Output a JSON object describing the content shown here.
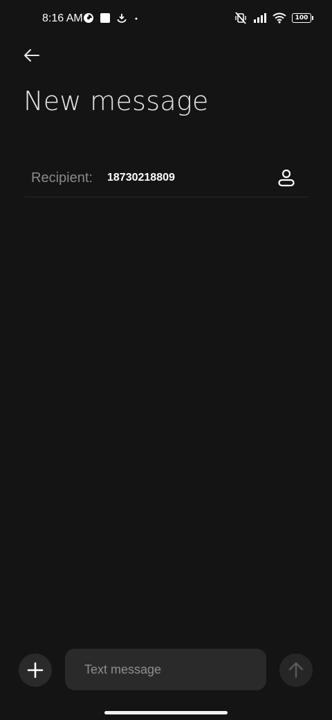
{
  "status_bar": {
    "time": "8:16 AM",
    "battery": "100",
    "left_icons": [
      "data-saver-icon",
      "square-app-icon",
      "download-icon",
      "dot-icon"
    ],
    "right_icons": [
      "vibrate-off-icon",
      "signal-icon",
      "wifi-icon",
      "battery-icon"
    ]
  },
  "header": {
    "back_icon": "arrow-left-icon",
    "title": "New message"
  },
  "recipient": {
    "label": "Recipient:",
    "value": "18730218809",
    "contact_icon": "person-icon"
  },
  "composer": {
    "add_icon": "plus-icon",
    "placeholder": "Text message",
    "value": "",
    "send_icon": "arrow-up-icon"
  },
  "colors": {
    "background": "#141414",
    "surface": "#2a2a2a",
    "muted_text": "#8a8a8a"
  }
}
